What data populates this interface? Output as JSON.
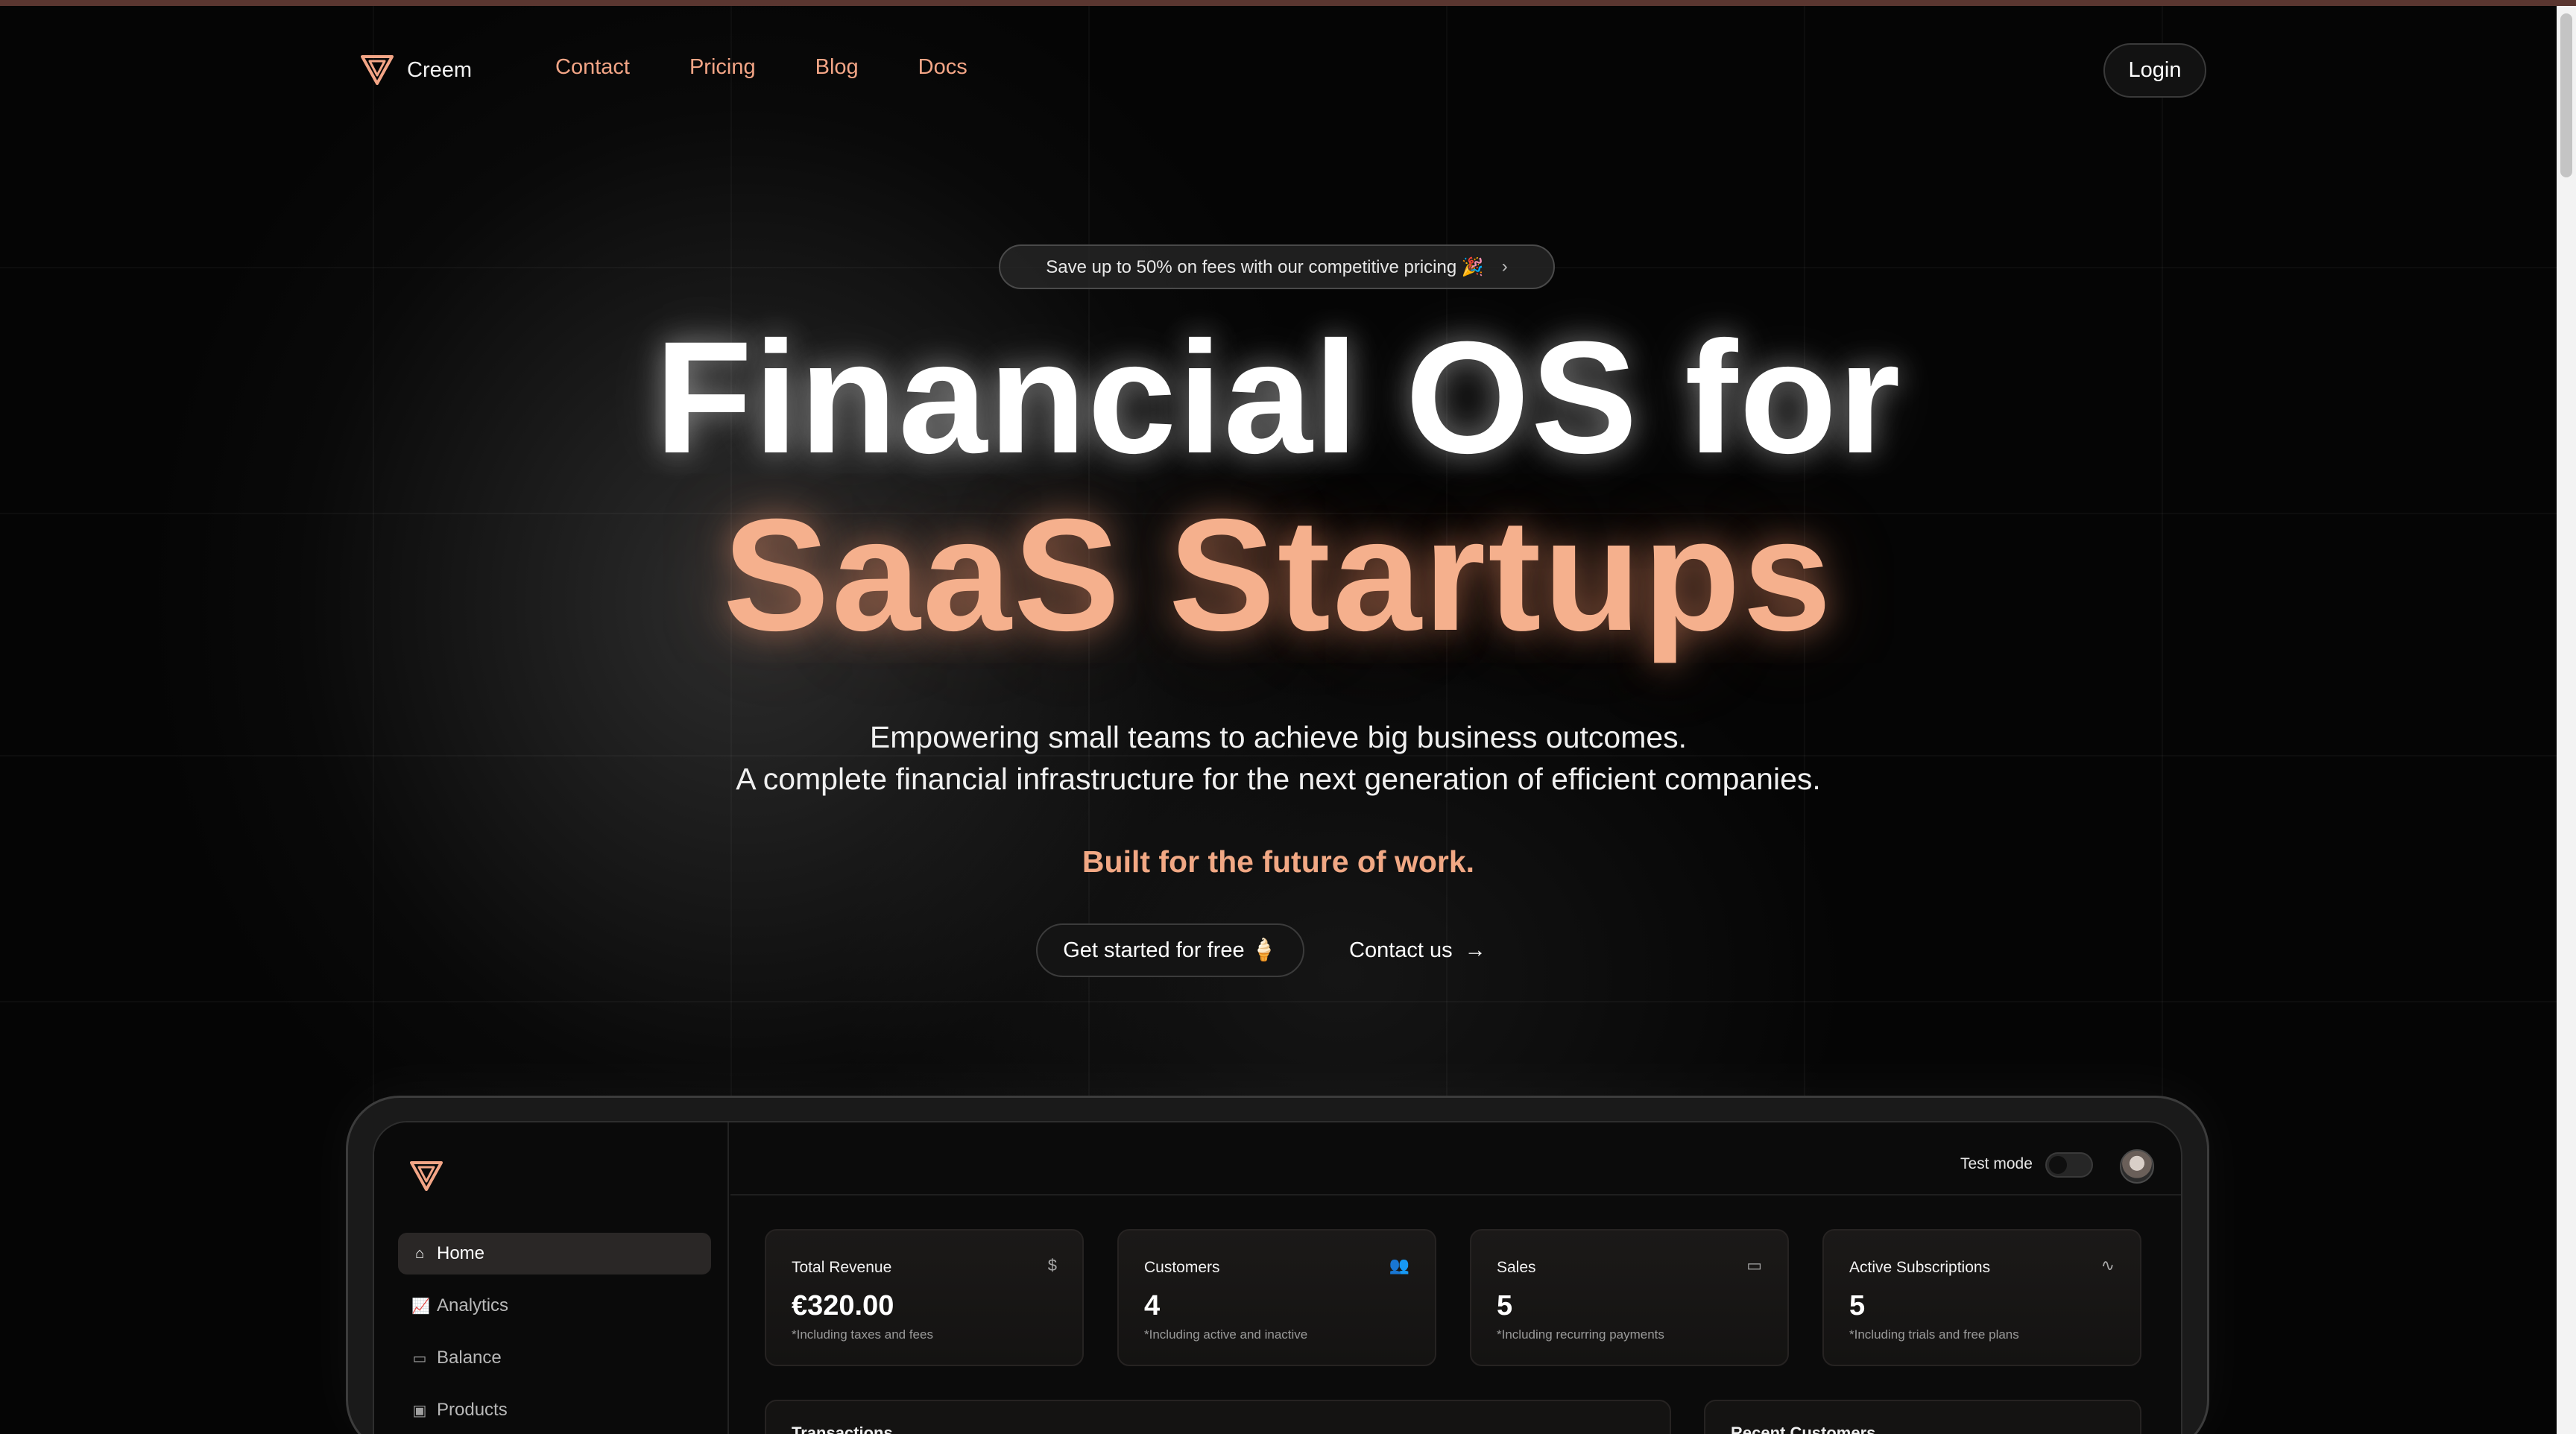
{
  "nav": {
    "brand": "Creem",
    "links": [
      "Contact",
      "Pricing",
      "Blog",
      "Docs"
    ],
    "login": "Login"
  },
  "hero": {
    "promo": "Save up to 50% on fees with our competitive pricing 🎉",
    "promo_arrow": "›",
    "title_line1": "Financial OS for",
    "title_line2": "SaaS Startups",
    "subtitle_line1": "Empowering small teams to achieve big business outcomes.",
    "subtitle_line2": "A complete financial infrastructure for the next generation of efficient companies.",
    "tagline": "Built for the future of work.",
    "cta_primary": "Get started for free 🍦",
    "cta_secondary": "Contact us",
    "cta_secondary_arrow": "→"
  },
  "dashboard": {
    "sidebar": [
      {
        "label": "Home",
        "icon": "home-icon",
        "glyph": "⌂",
        "active": true
      },
      {
        "label": "Analytics",
        "icon": "chart-icon",
        "glyph": "📈",
        "active": false
      },
      {
        "label": "Balance",
        "icon": "wallet-icon",
        "glyph": "▭",
        "active": false
      },
      {
        "label": "Products",
        "icon": "package-icon",
        "glyph": "▣",
        "active": false
      }
    ],
    "test_mode_label": "Test mode",
    "test_mode_on": false,
    "stats": [
      {
        "title": "Total Revenue",
        "value": "€320.00",
        "note": "*Including taxes and fees",
        "icon": "dollar-icon",
        "glyph": "$"
      },
      {
        "title": "Customers",
        "value": "4",
        "note": "*Including active and inactive",
        "icon": "users-icon",
        "glyph": "👥"
      },
      {
        "title": "Sales",
        "value": "5",
        "note": "*Including recurring payments",
        "icon": "credit-card-icon",
        "glyph": "▭"
      },
      {
        "title": "Active Subscriptions",
        "value": "5",
        "note": "*Including trials and free plans",
        "icon": "activity-icon",
        "glyph": "∿"
      }
    ],
    "panels": [
      "Transactions",
      "Recent Customers"
    ]
  },
  "colors": {
    "accent": "#f5b08d",
    "nav_link": "#f3a586",
    "background": "#060606"
  }
}
